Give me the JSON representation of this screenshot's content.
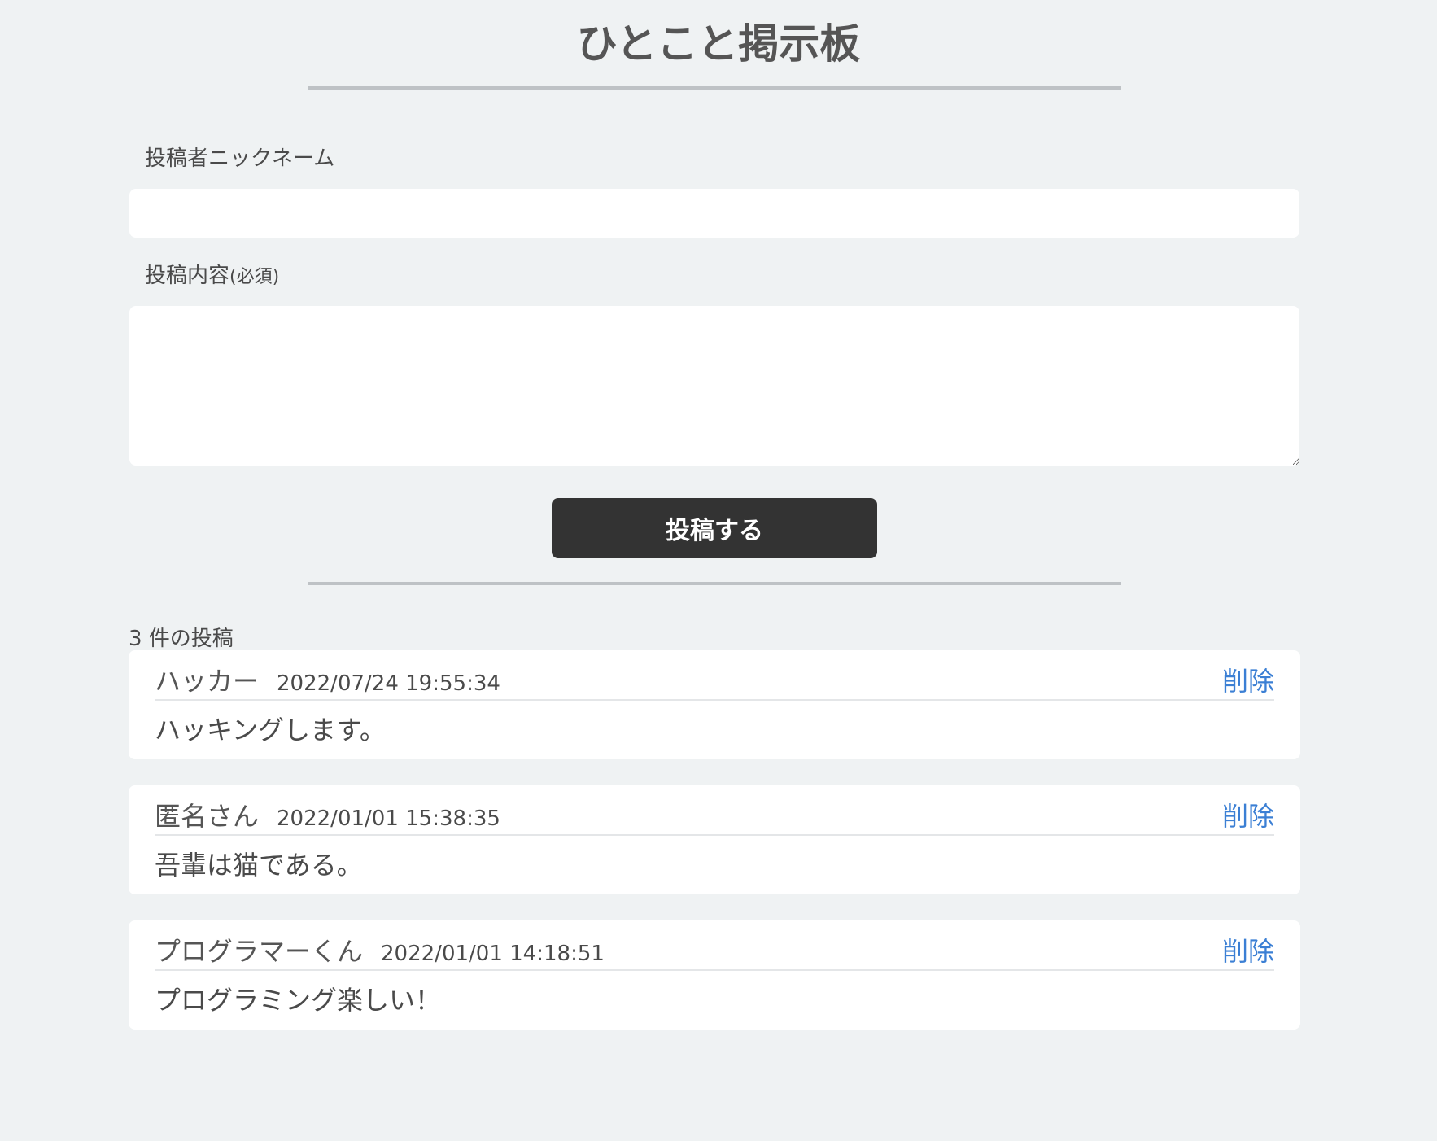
{
  "header": {
    "title": "ひとこと掲示板"
  },
  "form": {
    "nickname_label": "投稿者ニックネーム",
    "nickname_value": "",
    "content_label": "投稿内容",
    "content_required": "(必須)",
    "content_value": "",
    "submit_label": "投稿する"
  },
  "posts": {
    "count_text": "3 件の投稿",
    "delete_label": "削除",
    "items": [
      {
        "name": "ハッカー",
        "date": "2022/07/24 19:55:34",
        "body": "ハッキングします。"
      },
      {
        "name": "匿名さん",
        "date": "2022/01/01 15:38:35",
        "body": "吾輩は猫である。"
      },
      {
        "name": "プログラマーくん",
        "date": "2022/01/01 14:18:51",
        "body": "プログラミング楽しい！"
      }
    ]
  },
  "colors": {
    "background": "#eff2f3",
    "button": "#333333",
    "link": "#3b7fd4"
  }
}
